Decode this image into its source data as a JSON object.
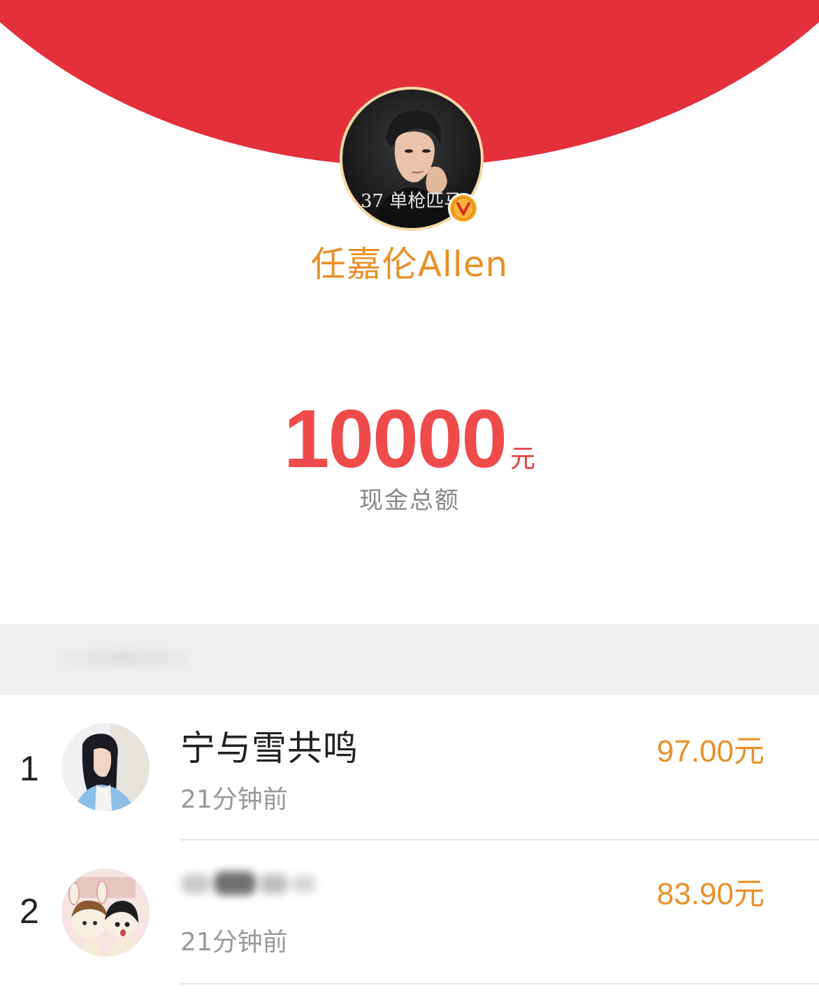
{
  "host": {
    "name": "任嘉伦Allen",
    "avatar_caption": "37 单枪匹马",
    "verified_icon": "verified-v-badge"
  },
  "total": {
    "amount": "10000",
    "unit": "元",
    "caption": "现金总额"
  },
  "colors": {
    "header_red": "#e3303b",
    "accent_orange": "#e8912b",
    "amount_red": "#ef4b4b"
  },
  "list": [
    {
      "rank": "1",
      "name": "宁与雪共鸣",
      "time": "21分钟前",
      "amount": "97.00元"
    },
    {
      "rank": "2",
      "name": "",
      "time": "21分钟前",
      "amount": "83.90元"
    }
  ]
}
